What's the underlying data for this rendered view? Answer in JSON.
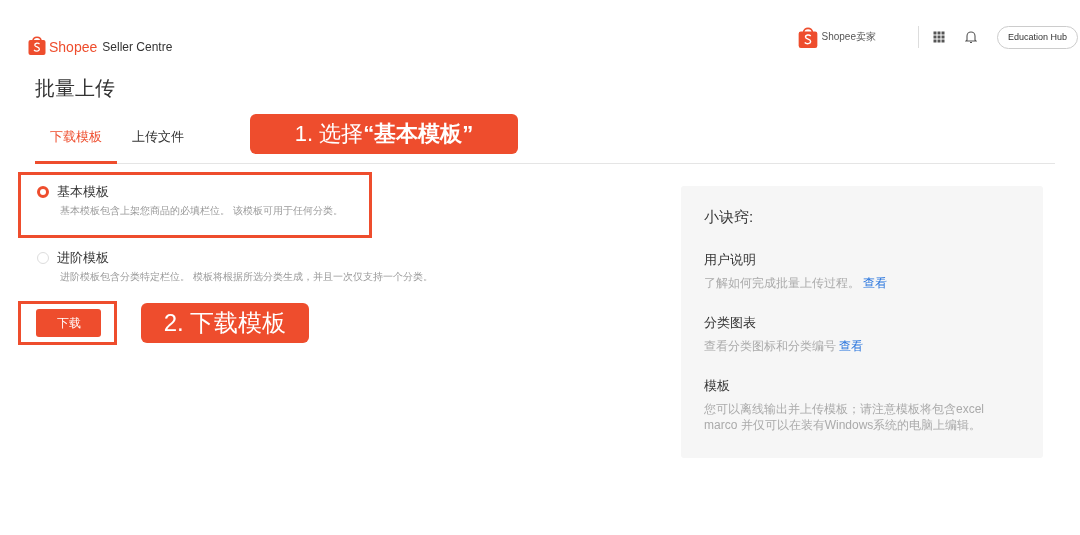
{
  "header": {
    "logo_text": "Shopee",
    "logo_subtitle": "Seller Centre",
    "partner_logo_text": "Shopee卖家",
    "education_button": "Education Hub"
  },
  "page_title": "批量上传",
  "tabs": [
    {
      "label": "下载模板",
      "selected": true
    },
    {
      "label": "上传文件",
      "selected": false
    }
  ],
  "tab_callout": "1. 选择**“基本模板”**",
  "template_options": [
    {
      "label": "基本模板",
      "description": "基本模板包含上架您商品的必填栏位。 该模板可用于任何分类。",
      "selected": true,
      "framed": true
    },
    {
      "label": "进阶模板",
      "description": "进阶模板包含分类特定栏位。 模板将根据所选分类生成，并且一次仅支持一个分类。",
      "selected": false,
      "framed": false
    }
  ],
  "download_button": {
    "label": "下载",
    "framed": true,
    "callout": "2. 下载模板"
  },
  "tips": {
    "title": "小诀窍:",
    "sections": [
      {
        "heading": "用户说明",
        "text": "了解如何完成批量上传过程。",
        "link": "查看"
      },
      {
        "heading": "分类图表",
        "text": "查看分类图标和分类编号",
        "link": "查看"
      },
      {
        "heading": "模板",
        "text": "您可以离线输出并上传模板；请注意模板将包含excel marco 并仅可以在装有Windows系统的电脑上编辑。"
      }
    ]
  }
}
